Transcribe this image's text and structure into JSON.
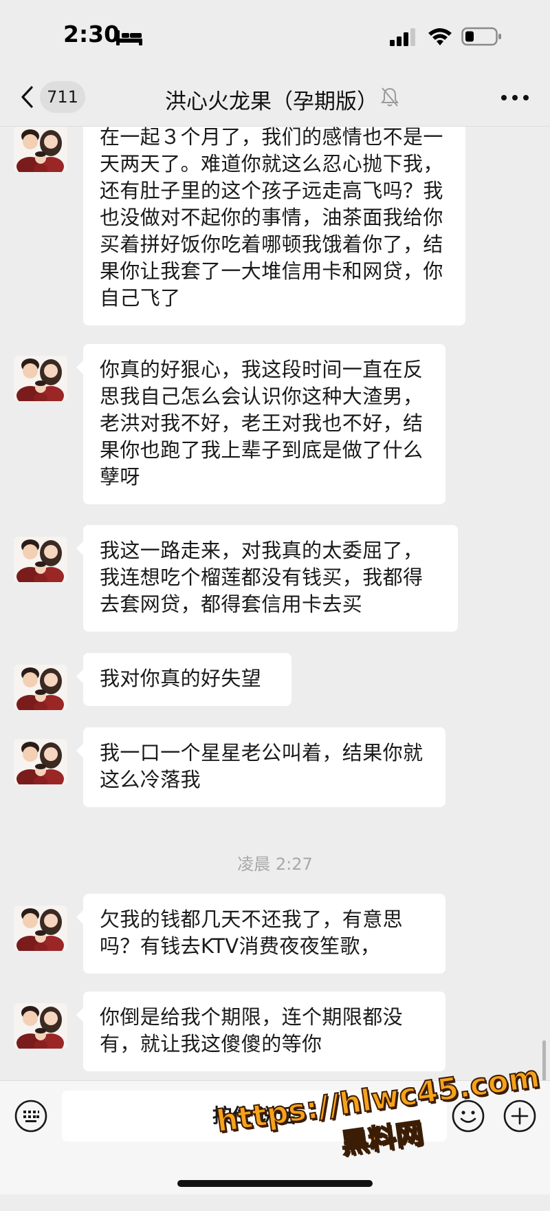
{
  "status_bar": {
    "time": "2:30"
  },
  "nav": {
    "unread_count": "711",
    "title": "洪心火龙果（孕期版）"
  },
  "messages": [
    {
      "sender": "contact",
      "text": "在一起３个月了，我们的感情也不是一天两天了。难道你就这么忍心抛下我，还有肚子里的这个孩子远走高飞吗？我也没做对不起你的事情，油茶面我给你买着拼好饭你吃着哪顿我饿着你了，结果你让我套了一大堆信用卡和网贷，你自己飞了"
    },
    {
      "sender": "contact",
      "text": "你真的好狠心，我这段时间一直在反思我自己怎么会认识你这种大渣男，老洪对我不好，老王对我也不好，结果你也跑了我上辈子到底是做了什么孽呀"
    },
    {
      "sender": "contact",
      "text": "我这一路走来，对我真的太委屈了，我连想吃个榴莲都没有钱买，我都得去套网贷，都得套信用卡去买"
    },
    {
      "sender": "contact",
      "text": "我对你真的好失望"
    },
    {
      "sender": "contact",
      "text": "我一口一个星星老公叫着，结果你就这么冷落我"
    },
    {
      "sender": "contact",
      "text": "欠我的钱都几天不还我了，有意思吗？有钱去KTV消费夜夜笙歌，"
    },
    {
      "sender": "contact",
      "text": "你倒是给我个期限，连个期限都没有，就让我这傻傻的等你"
    }
  ],
  "time_divider": "凌晨 2:27",
  "input_bar": {
    "voice_label": "按住 说话"
  },
  "watermark": {
    "url": "https://hlwc45.com",
    "name": "黑料网"
  },
  "icons": {
    "status": [
      "bed-icon",
      "signal-icon",
      "wifi-icon",
      "battery-icon"
    ],
    "nav": [
      "chevron-left-icon",
      "mute-bell-icon",
      "more-dots-icon"
    ],
    "input": [
      "keyboard-icon",
      "emoji-icon",
      "plus-icon"
    ]
  },
  "colors": {
    "background": "#ededed",
    "bubble": "#ffffff",
    "watermark": "#f7a21b"
  }
}
